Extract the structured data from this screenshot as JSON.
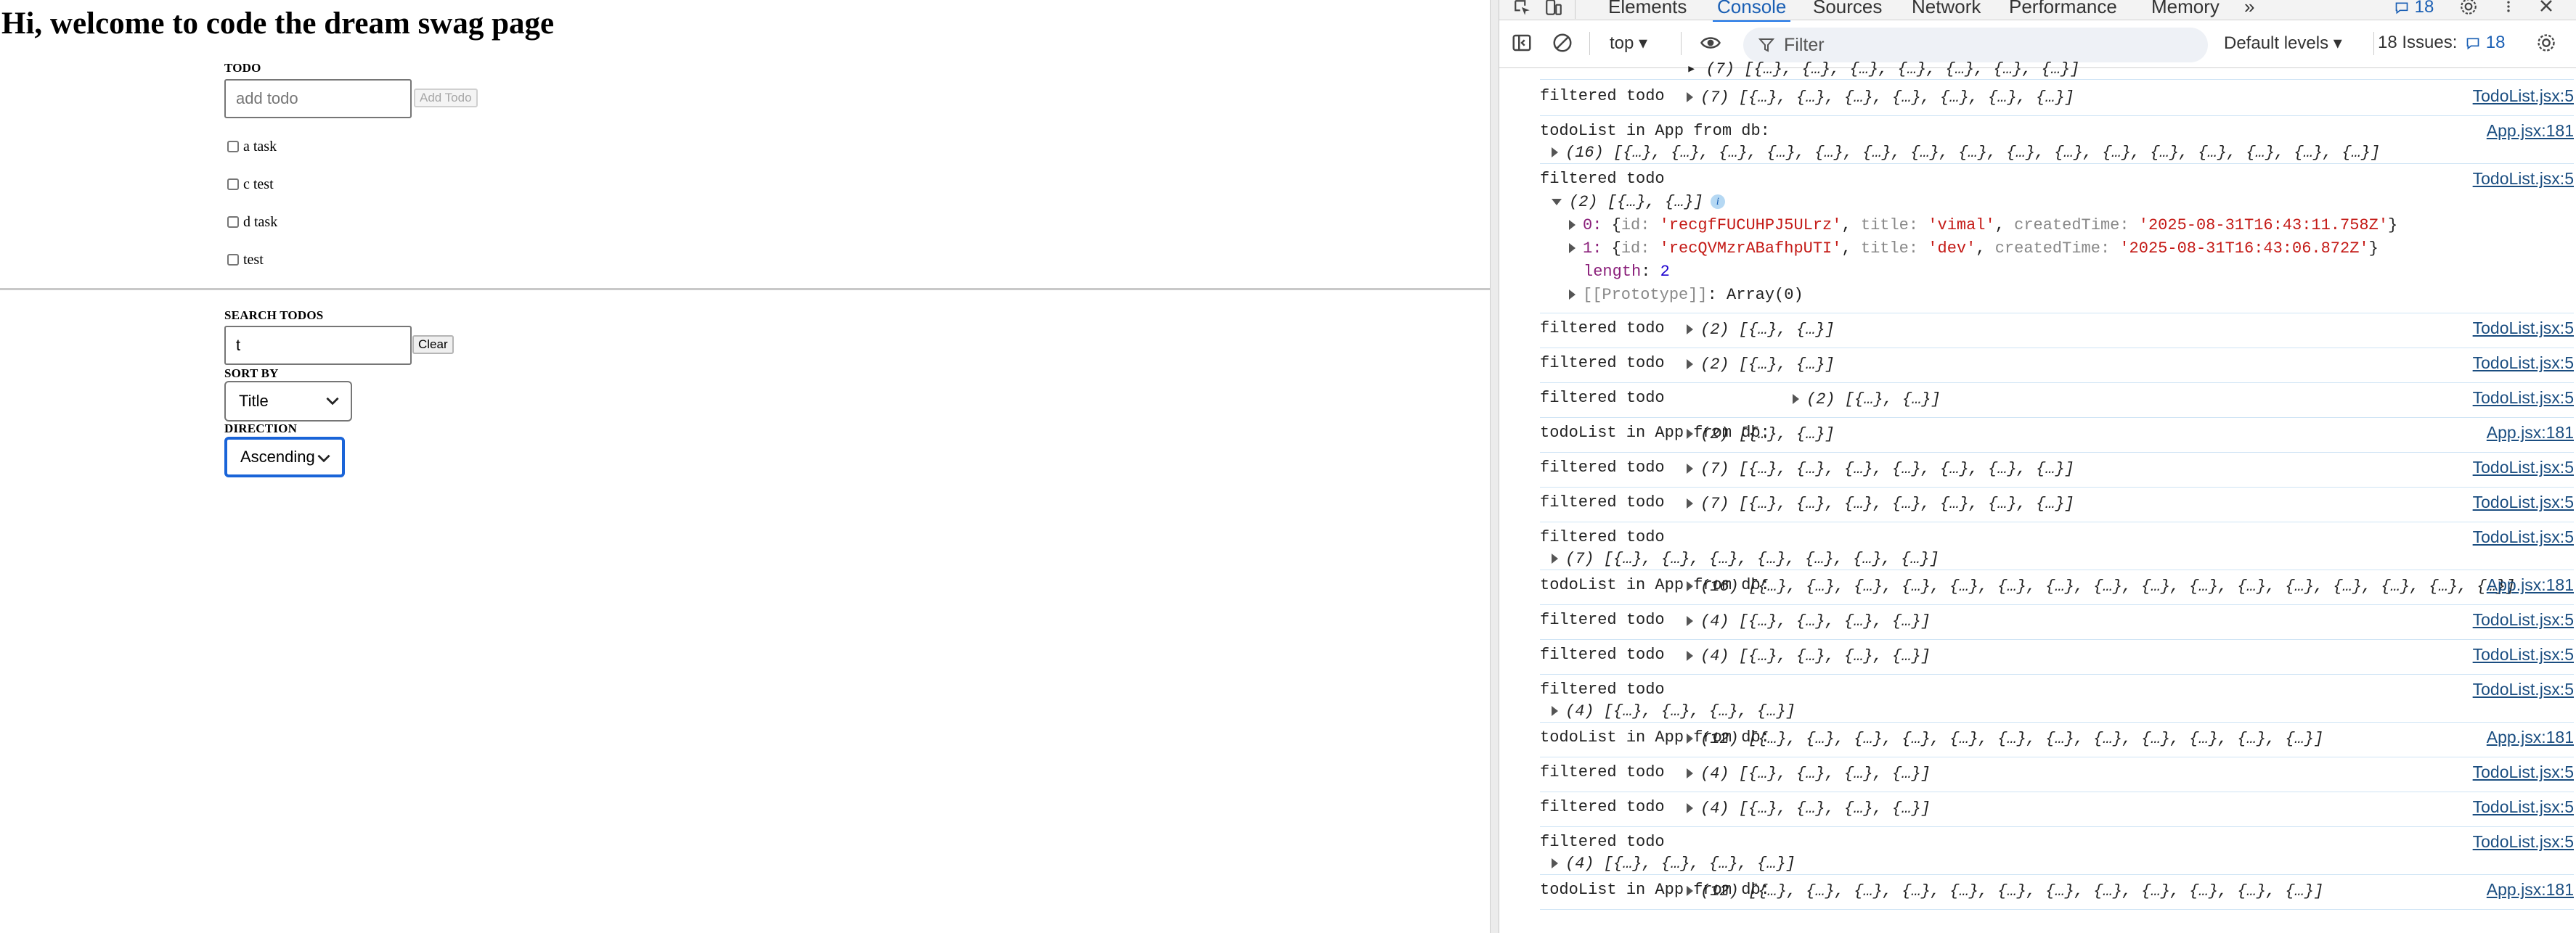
{
  "app": {
    "heading": "Hi, welcome to code the dream swag page",
    "todo_label": "TODO",
    "add_placeholder": "add todo",
    "add_button": "Add Todo",
    "todos": [
      "a task",
      "c test",
      "d task",
      "test"
    ],
    "search_label": "SEARCH TODOS",
    "search_value": "t",
    "clear_button": "Clear",
    "sort_label": "SORT BY",
    "sort_value": "Title",
    "direction_label": "DIRECTION",
    "direction_value": "Ascending"
  },
  "devtools": {
    "tabs": [
      "Elements",
      "Console",
      "Sources",
      "Network",
      "Performance",
      "Memory"
    ],
    "active_tab": "Console",
    "more": "»",
    "issue_badge": "18",
    "context": "top ▾",
    "filter_placeholder": "Filter",
    "levels": "Default levels ▾",
    "issues_text": "18 Issues:",
    "issues_count": "18",
    "entries": [
      {
        "msg": "filtered todo",
        "val": "(7) [{…}, {…}, {…}, {…}, {…}, {…}, {…}]",
        "src": "TodoList.jsx:5"
      },
      {
        "msg": "todoList in App from db:",
        "val": "(16) [{…}, {…}, {…}, {…}, {…}, {…}, {…}, {…}, {…}, {…}, {…}, {…}, {…}, {…}, {…}, {…}]",
        "src": "App.jsx:181"
      },
      {
        "msg": "filtered todo",
        "val": "(2) [{…}, {…}]",
        "src": "TodoList.jsx:5"
      },
      {
        "msg": "filtered todo",
        "val": "(2) [{…}, {…}]",
        "src": "TodoList.jsx:5"
      },
      {
        "msg": "filtered todo",
        "val": "(2) [{…}, {…}]",
        "src": "TodoList.jsx:5"
      },
      {
        "msg": "todoList in App from db:",
        "val": "(2) [{…}, {…}]",
        "src": "App.jsx:181"
      },
      {
        "msg": "filtered todo",
        "val": "(7) [{…}, {…}, {…}, {…}, {…}, {…}, {…}]",
        "src": "TodoList.jsx:5"
      },
      {
        "msg": "filtered todo",
        "val": "(7) [{…}, {…}, {…}, {…}, {…}, {…}, {…}]",
        "src": "TodoList.jsx:5"
      },
      {
        "msg": "filtered todo",
        "val": "(7) [{…}, {…}, {…}, {…}, {…}, {…}, {…}]",
        "src": "TodoList.jsx:5"
      },
      {
        "msg": "todoList in App from db:",
        "val": "(16) [{…}, {…}, {…}, {…}, {…}, {…}, {…}, {…}, {…}, {…}, {…}, {…}, {…}, {…}, {…}, {…}]",
        "src": "App.jsx:181"
      },
      {
        "msg": "filtered todo",
        "val": "(4) [{…}, {…}, {…}, {…}]",
        "src": "TodoList.jsx:5"
      },
      {
        "msg": "filtered todo",
        "val": "(4) [{…}, {…}, {…}, {…}]",
        "src": "TodoList.jsx:5"
      },
      {
        "msg": "filtered todo",
        "val": "(4) [{…}, {…}, {…}, {…}]",
        "src": "TodoList.jsx:5"
      },
      {
        "msg": "todoList in App from db:",
        "val": "(12) [{…}, {…}, {…}, {…}, {…}, {…}, {…}, {…}, {…}, {…}, {…}, {…}]",
        "src": "App.jsx:181"
      },
      {
        "msg": "filtered todo",
        "val": "(4) [{…}, {…}, {…}, {…}]",
        "src": "TodoList.jsx:5"
      },
      {
        "msg": "filtered todo",
        "val": "(4) [{…}, {…}, {…}, {…}]",
        "src": "TodoList.jsx:5"
      },
      {
        "msg": "filtered todo",
        "val": "(4) [{…}, {…}, {…}, {…}]",
        "src": "TodoList.jsx:5"
      },
      {
        "msg": "todoList in App from db:",
        "val": "(12) [{…}, {…}, {…}, {…}, {…}, {…}, {…}, {…}, {…}, {…}, {…}, {…}]",
        "src": "App.jsx:181"
      },
      {
        "msg": "filtered todo",
        "val": "(4) [{…}, {…}, {…}, {…}]",
        "src": "TodoList.jsx:5"
      }
    ],
    "expanded": {
      "item0_key": "0:",
      "item0_id": "'recgfFUCUHPJ5ULrz'",
      "item0_title": "'vimal'",
      "item0_time": "'2025-08-31T16:43:11.758Z'",
      "item1_key": "1:",
      "item1_id": "'recQVMzrABafhpUTI'",
      "item1_title": "'dev'",
      "item1_time": "'2025-08-31T16:43:06.872Z'",
      "length_key": "length",
      "length_val": "2",
      "proto_key": "[[Prototype]]",
      "proto_val": "Array(0)",
      "k_id": "id:",
      "k_title": "title:",
      "k_time": "createdTime:"
    }
  }
}
